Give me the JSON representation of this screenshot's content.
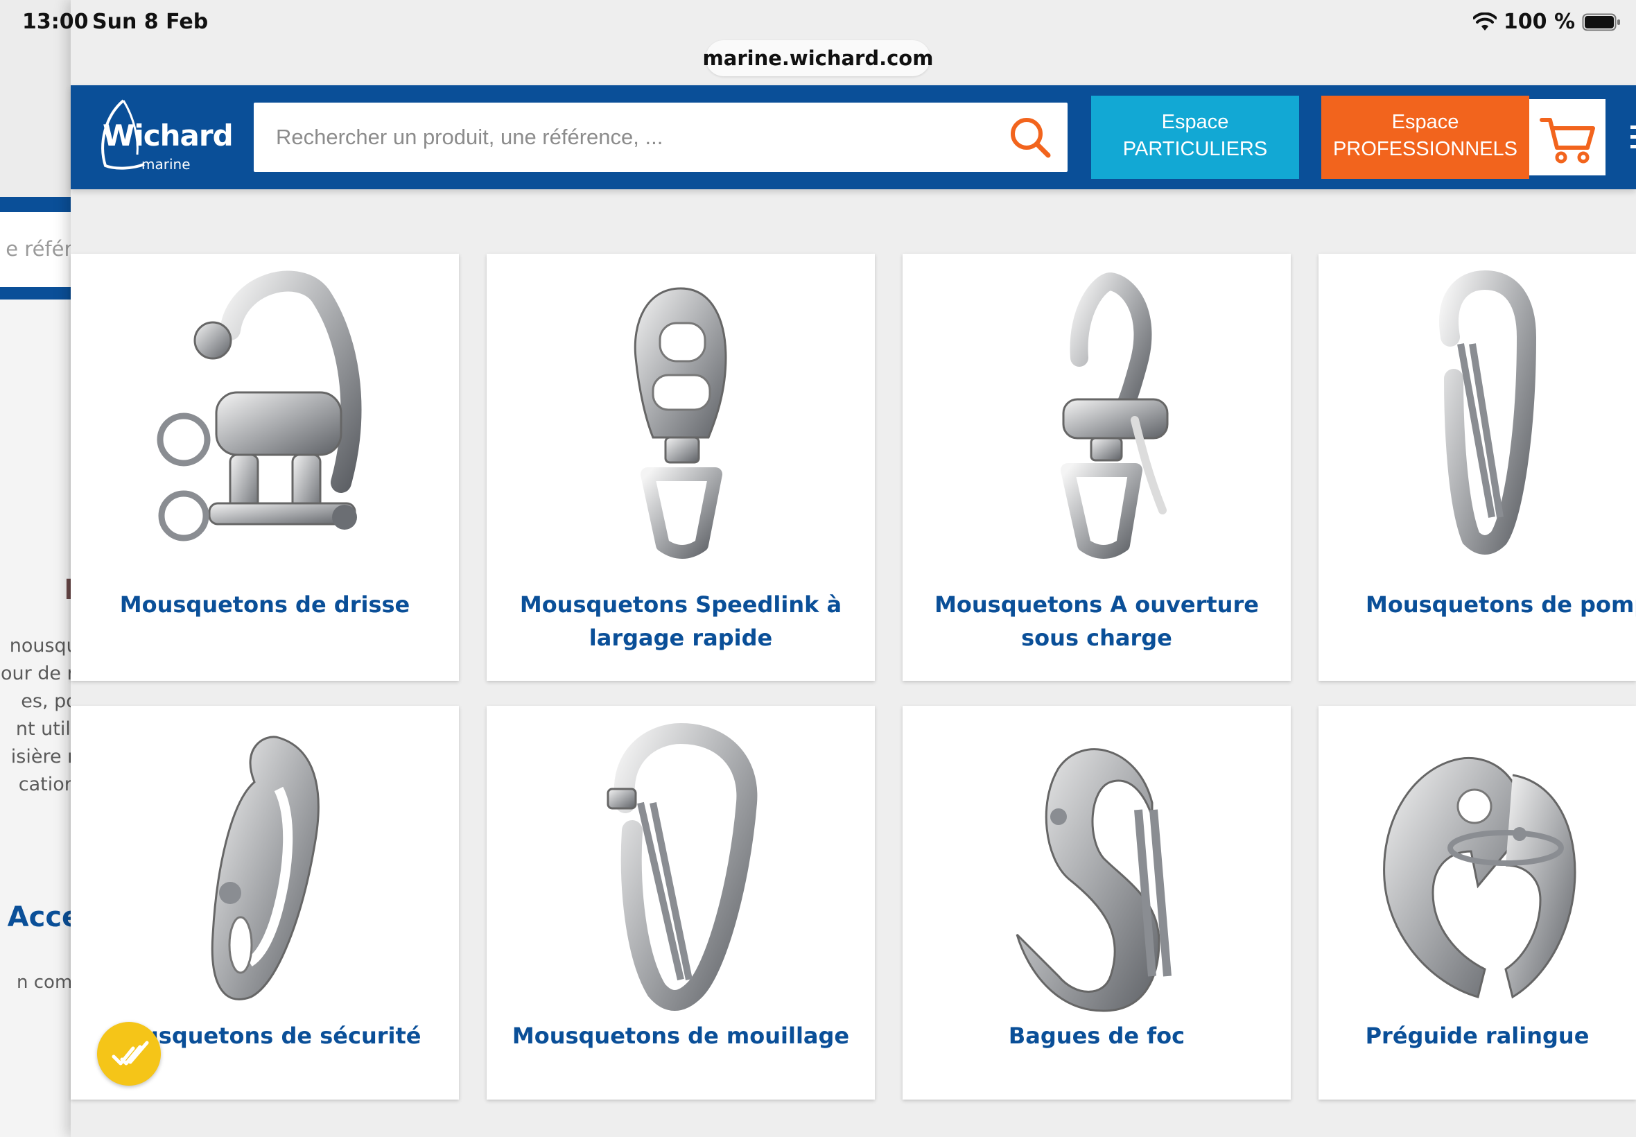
{
  "status_bar": {
    "time": "13:00",
    "date": "Sun 8 Feb",
    "battery": "100 %"
  },
  "background_page": {
    "search_fragment": "e référen",
    "heading_fragment": "M",
    "paragraph_fragments": [
      "nousquet",
      "our de mu",
      "es, pour",
      "nt utilisa",
      "isière ma",
      "cations i"
    ],
    "access_fragment": "Acces",
    "bottom_fragment": "n complé"
  },
  "browser": {
    "url": "marine.wichard.com"
  },
  "header": {
    "logo_text": "Wichard",
    "logo_sub": "marine",
    "search_placeholder": "Rechercher un produit, une référence, ...",
    "particuliers": {
      "line1": "Espace",
      "line2": "PARTICULIERS"
    },
    "professionnels": {
      "line1": "Espace",
      "line2": "PROFESSIONNELS"
    }
  },
  "products": [
    {
      "label": "Mousquetons de drisse",
      "icon": "snap-shackle-icon"
    },
    {
      "label": "Mousquetons Speedlink à largage rapide",
      "icon": "speedlink-snap-icon"
    },
    {
      "label": "Mousquetons A ouverture sous charge",
      "icon": "load-release-snap-icon"
    },
    {
      "label": "Mousquetons de pompi",
      "icon": "carabiner-icon"
    },
    {
      "label": "usquetons de sécurité",
      "icon": "safety-snap-icon"
    },
    {
      "label": "Mousquetons de mouillage",
      "icon": "mooring-snap-icon"
    },
    {
      "label": "Bagues de foc",
      "icon": "jib-hank-icon"
    },
    {
      "label": "Préguide ralingue",
      "icon": "luff-feeder-icon"
    }
  ],
  "colors": {
    "brand_blue": "#0a4f98",
    "particuliers": "#12a8d4",
    "professionnels": "#f2641d",
    "badge": "#f5c518"
  }
}
